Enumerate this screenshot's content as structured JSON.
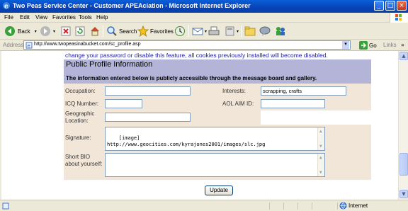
{
  "window": {
    "title": "Two Peas Service Center - Customer APEAciation - Microsoft Internet Explorer"
  },
  "menu": {
    "items": [
      "File",
      "Edit",
      "View",
      "Favorites",
      "Tools",
      "Help"
    ]
  },
  "toolbar": {
    "back_label": "Back",
    "search_label": "Search",
    "favorites_label": "Favorites"
  },
  "address": {
    "label": "Address",
    "url": "http://www.twopeasinabucket.com/sc_profile.asp",
    "go_label": "Go",
    "links_label": "Links"
  },
  "page": {
    "notice": "change your password or disable this feature, all cookies previously installed will become disabled.",
    "section_title": "Public Profile Information",
    "section_subtitle": "The information entered below is publicly accessible through the message board and gallery.",
    "fields": {
      "occupation": {
        "label": "Occupation:",
        "value": ""
      },
      "interests": {
        "label": "Interests:",
        "value": "scrapping, crafts"
      },
      "icq": {
        "label": "ICQ Number:",
        "value": ""
      },
      "aim": {
        "label": "AOL AIM ID:",
        "value": ""
      },
      "location": {
        "label": "Geographic Location:",
        "value": ""
      },
      "signature": {
        "label": "Signature:",
        "value": "[image]\nhttp://www.geocities.com/kyrajones2001/images/slc.jpg"
      },
      "bio": {
        "label": "Short BIO about yourself:",
        "value": ""
      }
    },
    "update_label": "Update"
  },
  "status": {
    "zone_label": "Internet"
  },
  "colors": {
    "title_bar": "#0842b8",
    "section_header": "#b4b4d8",
    "form_background": "#f2e6d8",
    "link_text": "#1a1ab0"
  }
}
